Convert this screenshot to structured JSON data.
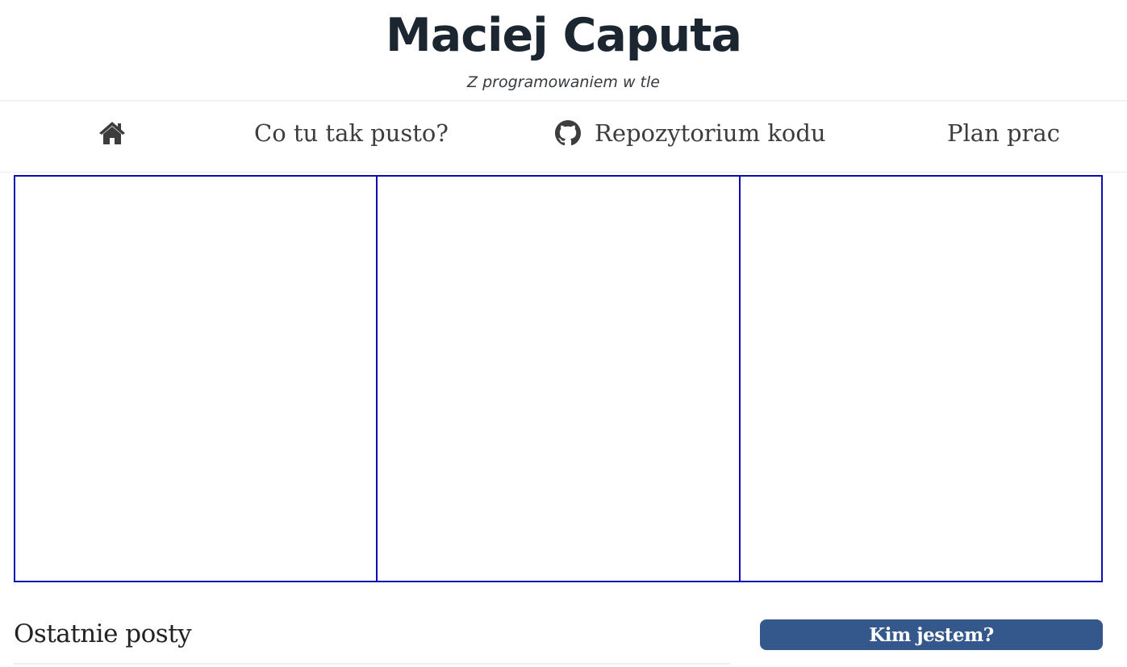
{
  "header": {
    "title": "Maciej Caputa",
    "tagline": "Z programowaniem w tle"
  },
  "nav": {
    "home_icon": "home-icon",
    "items": [
      {
        "label": "Co tu tak pusto?"
      },
      {
        "label": "Repozytorium kodu",
        "icon": "github-icon"
      },
      {
        "label": "Plan prac"
      }
    ]
  },
  "colors": {
    "title": "#1b2631",
    "panel_border": "#0b0bb0",
    "button_bg": "#34588b",
    "button_text": "#ffffff"
  },
  "main": {
    "recent_posts_title": "Ostatnie posty"
  },
  "sidebar": {
    "about_button_label": "Kim jestem?"
  }
}
